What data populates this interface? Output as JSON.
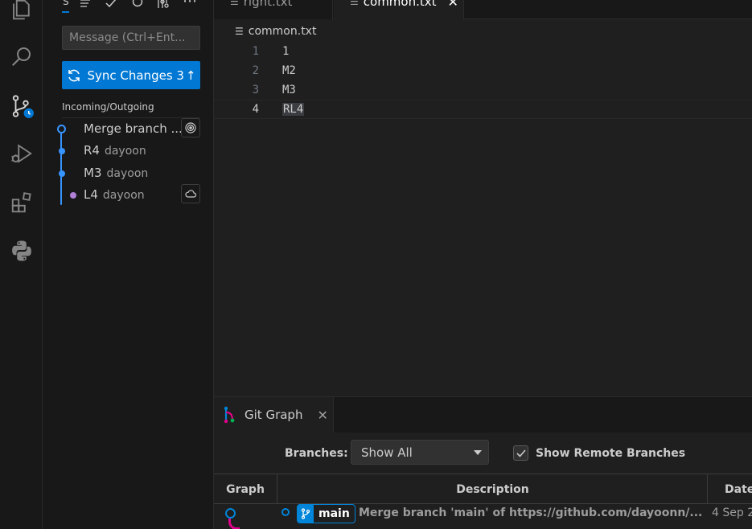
{
  "activity_bar": {
    "icons": [
      "explorer-icon",
      "search-icon",
      "source-control-icon",
      "run-debug-icon",
      "extensions-icon",
      "python-icon"
    ]
  },
  "sidebar": {
    "toolbar_label": "S",
    "message_placeholder": "Message (Ctrl+Ent...",
    "sync_button": {
      "label": "Sync Changes 3",
      "arrow": "↑"
    },
    "section_title": "Incoming/Outgoing",
    "commits": [
      {
        "title": "Merge branch ...",
        "author": ""
      },
      {
        "title": "R4",
        "author": "dayoon"
      },
      {
        "title": "M3",
        "author": "dayoon"
      },
      {
        "title": "L4",
        "author": "dayoon"
      }
    ]
  },
  "editor": {
    "tabs": [
      {
        "label": "right.txt",
        "active": false
      },
      {
        "label": "common.txt",
        "active": true,
        "close": "✕"
      }
    ],
    "breadcrumb": "common.txt",
    "lines": [
      {
        "num": "1",
        "text": "1"
      },
      {
        "num": "2",
        "text": "M2"
      },
      {
        "num": "3",
        "text": "M3"
      },
      {
        "num": "4",
        "text": "RL4"
      }
    ]
  },
  "panel": {
    "tab_label": "Git Graph",
    "tab_close": "✕",
    "branches_label": "Branches:",
    "branches_value": "Show All",
    "remote_label": "Show Remote Branches",
    "columns": {
      "graph": "Graph",
      "description": "Description",
      "date": "Date"
    },
    "row": {
      "branch": "main",
      "message": "Merge branch 'main' of https://github.com/dayoonn/...",
      "date": "4 Sep 2"
    }
  },
  "colors": {
    "accent": "#0078d4",
    "graph_blue": "#0085d9",
    "graph_pink": "#e2008a",
    "commit_blue": "#3794ff",
    "commit_purple": "#b180d7"
  }
}
